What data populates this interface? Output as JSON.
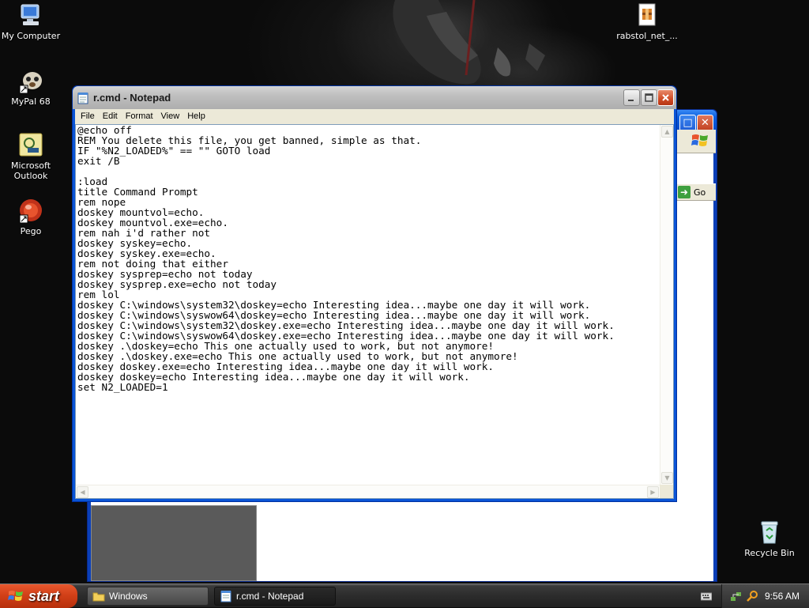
{
  "desktop": {
    "icons": [
      {
        "label": "My Computer",
        "icon": "computer-icon"
      },
      {
        "label": "MyPal 68",
        "icon": "mypal-browser-icon"
      },
      {
        "label": "Microsoft Outlook",
        "icon": "outlook-icon"
      },
      {
        "label": "Pego",
        "icon": "pego-icon"
      },
      {
        "label": "rabstol_net_...",
        "icon": "archive-file-icon"
      },
      {
        "label": "Recycle Bin",
        "icon": "recycle-bin-icon"
      }
    ]
  },
  "background_window": {
    "go_label": "Go"
  },
  "notepad": {
    "title": "r.cmd - Notepad",
    "menu": [
      "File",
      "Edit",
      "Format",
      "View",
      "Help"
    ],
    "lines": [
      "@echo off",
      "REM You delete this file, you get banned, simple as that.",
      "IF \"%N2_LOADED%\" == \"\" GOTO load",
      "exit /B",
      "",
      ":load",
      "title Command Prompt",
      "rem nope",
      "doskey mountvol=echo.",
      "doskey mountvol.exe=echo.",
      "rem nah i'd rather not",
      "doskey syskey=echo.",
      "doskey syskey.exe=echo.",
      "rem not doing that either",
      "doskey sysprep=echo not today",
      "doskey sysprep.exe=echo not today",
      "rem lol",
      "doskey C:\\windows\\system32\\doskey=echo Interesting idea...maybe one day it will work.",
      "doskey C:\\windows\\syswow64\\doskey=echo Interesting idea...maybe one day it will work.",
      "doskey C:\\windows\\system32\\doskey.exe=echo Interesting idea...maybe one day it will work.",
      "doskey C:\\windows\\syswow64\\doskey.exe=echo Interesting idea...maybe one day it will work.",
      "doskey .\\doskey=echo This one actually used to work, but not anymore!",
      "doskey .\\doskey.exe=echo This one actually used to work, but not anymore!",
      "doskey doskey.exe=echo Interesting idea...maybe one day it will work.",
      "doskey doskey=echo Interesting idea...maybe one day it will work.",
      "set N2_LOADED=1"
    ]
  },
  "taskbar": {
    "start_label": "start",
    "tasks": [
      {
        "label": "Windows",
        "icon": "folder-icon",
        "active": false
      },
      {
        "label": "r.cmd - Notepad",
        "icon": "notepad-icon",
        "active": true
      }
    ],
    "clock": "9:56 AM"
  },
  "colors": {
    "xp_blue": "#0a54d6",
    "start_orange": "#d24018",
    "desktop_dark": "#0d0d0d"
  }
}
